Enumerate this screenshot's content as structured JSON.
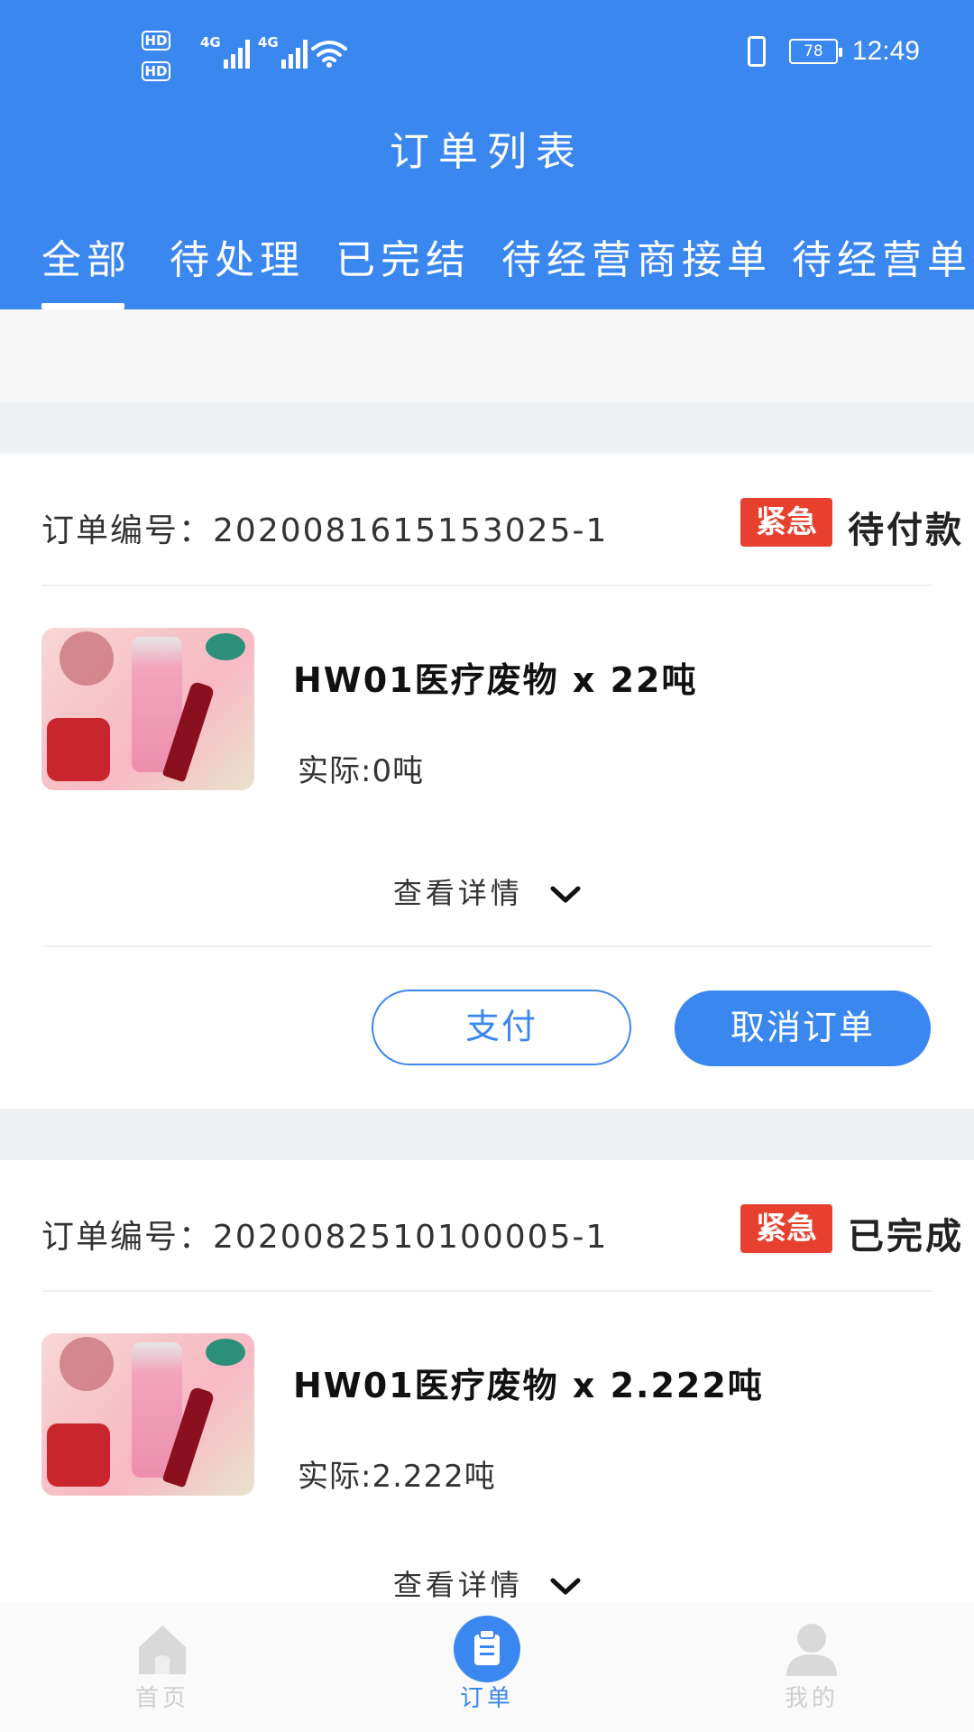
{
  "status_bar": {
    "sim1": "HD",
    "sim2": "HD",
    "net1": "4G",
    "net2": "4G",
    "battery": "78",
    "time": "12:49"
  },
  "header": {
    "title": "订单列表"
  },
  "tabs": [
    {
      "label": "全部",
      "active": true
    },
    {
      "label": "待处理"
    },
    {
      "label": "已完结"
    },
    {
      "label": "待经营商接单"
    },
    {
      "label": "待经营单位"
    }
  ],
  "orders": [
    {
      "order_no_label": "订单编号：",
      "order_no": "2020081615153025-1",
      "urgent": "紧急",
      "status": "待付款",
      "item_title": "HW01医疗废物 x 22吨",
      "actual": "实际:0吨",
      "details": "查看详情",
      "buttons": {
        "pay": "支付",
        "cancel": "取消订单"
      }
    },
    {
      "order_no_label": "订单编号：",
      "order_no": "2020082510100005-1",
      "urgent": "紧急",
      "status": "已完成",
      "item_title": "HW01医疗废物 x 2.222吨",
      "actual": "实际:2.222吨",
      "details": "查看详情"
    }
  ],
  "bottom_nav": [
    {
      "label": "首页",
      "icon": "home-icon"
    },
    {
      "label": "订单",
      "icon": "order-icon",
      "active": true
    },
    {
      "label": "我的",
      "icon": "user-icon"
    }
  ],
  "colors": {
    "brand": "#3a87f0",
    "urgent": "#e8402e"
  }
}
